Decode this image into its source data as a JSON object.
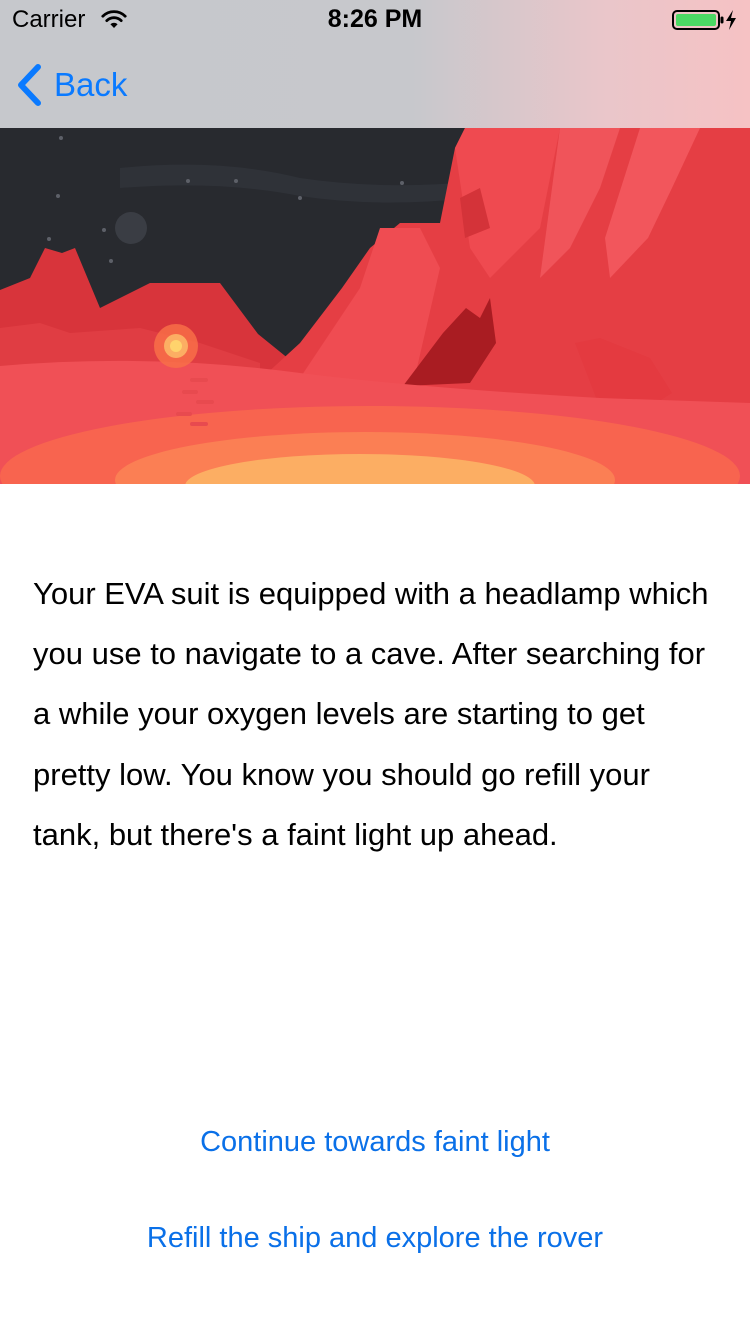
{
  "status_bar": {
    "carrier": "Carrier",
    "time": "8:26 PM",
    "battery_charging": true
  },
  "nav": {
    "back_label": "Back"
  },
  "page": {
    "story_text": "Your EVA suit is equipped with a headlamp which you use to navigate to a cave. After searching for a while your oxygen levels are starting to get pretty low. You know you should go refill your tank, but there's a faint light up ahead."
  },
  "choices": [
    {
      "label": "Continue towards faint light"
    },
    {
      "label": "Refill the ship and explore the rover"
    }
  ],
  "colors": {
    "accent": "#0a7aff",
    "sky": "#282a2f",
    "terrain_red": "#f0454b",
    "terrain_dark_red": "#a91c22",
    "glow_orange": "#f86f48",
    "glow_yellow": "#fcae63",
    "battery_green": "#4cd964"
  },
  "icons": {
    "wifi": "wifi-icon",
    "battery": "battery-charging-icon",
    "back": "chevron-left-icon"
  }
}
